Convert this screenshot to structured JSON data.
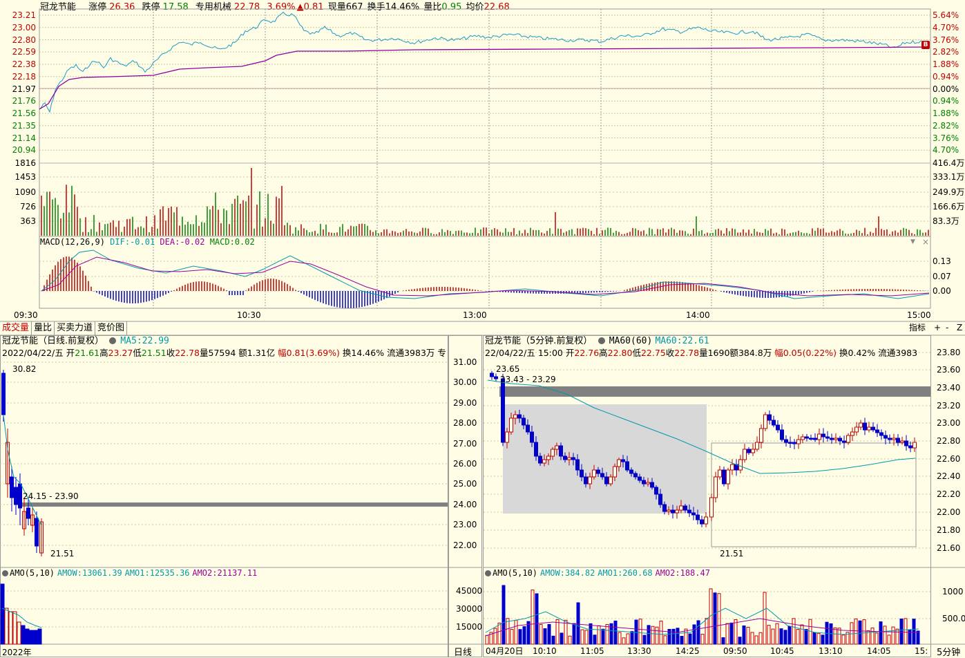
{
  "colors": {
    "up": "#c00000",
    "down": "#0000cc",
    "green": "#008000",
    "cyan": "#0099aa",
    "purple": "#990099",
    "grid": "#c8c8a0",
    "bg": "#fffde6"
  },
  "top": {
    "stock_name": "冠龙节能",
    "limit_up_label": "涨停",
    "limit_up": "26.36",
    "limit_down_label": "跌停",
    "limit_down": "17.58",
    "industry": "专用机械",
    "price": "22.78",
    "pct": "3.69%",
    "change": "▲0.81",
    "vol_label": "现量",
    "vol": "667",
    "turnover_label": "换手",
    "turnover": "14.46%",
    "ratio_label": "量比",
    "ratio": "0.95",
    "avg_label": "均价",
    "avg": "22.68"
  },
  "intraday": {
    "price_ticks": [
      "23.21",
      "23.00",
      "22.80",
      "22.59",
      "22.38",
      "22.18",
      "21.97",
      "21.76",
      "21.56",
      "21.35",
      "21.14",
      "20.94"
    ],
    "pct_ticks": [
      "5.64%",
      "4.70%",
      "3.76%",
      "2.82%",
      "1.88%",
      "0.94%",
      "0.00%",
      "0.94%",
      "1.88%",
      "2.82%",
      "3.76%",
      "4.70%"
    ],
    "vol_ticks": [
      "1816",
      "1453",
      "1090",
      "726",
      "363"
    ],
    "vol_ticks_right": [
      "416.4万",
      "333.1万",
      "249.9万",
      "166.6万",
      "83.3万"
    ],
    "marker": "B",
    "macd": {
      "name": "MACD(12,26,9)",
      "dif_label": "DIF:",
      "dif": "-0.01",
      "dea_label": "DEA:",
      "dea": "-0.02",
      "macd_label": "MACD:",
      "macd": "0.02",
      "ticks": [
        "0.13",
        "0.07",
        "0.00"
      ]
    },
    "time_ticks": [
      "09:30",
      "10:30",
      "13:00",
      "14:00",
      "15:00"
    ],
    "menu_icon": "chevron-down-icon",
    "close_icon": "close-icon"
  },
  "tabs": [
    "成交量",
    "量比",
    "买卖力道",
    "竞价图"
  ],
  "right_buttons": {
    "indicator": "指标",
    "plus": "+",
    "minus": "-",
    "z": "Z"
  },
  "daily": {
    "title": "冠龙节能（日线.前复权）",
    "ma_label": "MA5:",
    "ma": "22.99",
    "info": {
      "date": "2022/04/22/五",
      "open_l": "开",
      "open": "21.61",
      "high_l": "高",
      "high": "23.27",
      "low_l": "低",
      "low": "21.51",
      "close_l": "收",
      "close": "22.78",
      "vol_l": "量",
      "vol": "57594",
      "amt_l": "额",
      "amt": "1.31亿",
      "amp_l": "幅",
      "amp": "0.81(3.69%)",
      "turn_l": "换",
      "turn": "14.46%",
      "float_l": "流通",
      "float": "3983万",
      "extra": "专"
    },
    "ticks": [
      "31.00",
      "30.00",
      "29.00",
      "28.00",
      "27.00",
      "26.00",
      "25.00",
      "24.00",
      "23.00",
      "22.00"
    ],
    "hi_label": "30.82",
    "lo_label": "21.51",
    "zone_label": "24.15 - 23.90",
    "amo": {
      "name": "AMO(5,10)",
      "w_label": "AMOW:",
      "w": "13061.39",
      "a1_label": "AMO1:",
      "a1": "12535.36",
      "a2_label": "AMO2:",
      "a2": "21137.11",
      "ticks": [
        "45000",
        "30000",
        "15000"
      ]
    },
    "year": "2022年",
    "period": "日线"
  },
  "m5": {
    "title": "冠龙节能（5分钟.前复权）",
    "ma_name": "MA60(60)",
    "ma_label": "MA60:",
    "ma": "22.61",
    "info": {
      "date": "22/04/22/五 15:00",
      "open_l": "开",
      "open": "22.76",
      "high_l": "高",
      "high": "22.80",
      "low_l": "低",
      "low": "22.75",
      "close_l": "收",
      "close": "22.78",
      "vol_l": "量",
      "vol": "1690",
      "amt_l": "额",
      "amt": "384.8万",
      "amp_l": "幅",
      "amp": "0.05(0.22%)",
      "turn_l": "换",
      "turn": "0.42%",
      "float_l": "流通",
      "float": "3983"
    },
    "ticks": [
      "23.80",
      "23.60",
      "23.40",
      "23.20",
      "23.00",
      "22.80",
      "22.60",
      "22.40",
      "22.20",
      "22.00",
      "21.80",
      "21.60"
    ],
    "hi_label": "23.65",
    "lo_label": "21.51",
    "zone_label": "23.43 - 23.29",
    "amo": {
      "name": "AMO(5,10)",
      "w_label": "AMOW:",
      "w": "384.82",
      "a1_label": "AMO1:",
      "a1": "260.68",
      "a2_label": "AMO2:",
      "a2": "188.47",
      "ticks": [
        "1000",
        "500.0"
      ]
    },
    "time_ticks": [
      "04月20日",
      "10:10",
      "11:05",
      "13:30",
      "14:25",
      "09:50",
      "10:45",
      "13:10",
      "14:05",
      "15:"
    ],
    "period": "5分钟"
  }
}
